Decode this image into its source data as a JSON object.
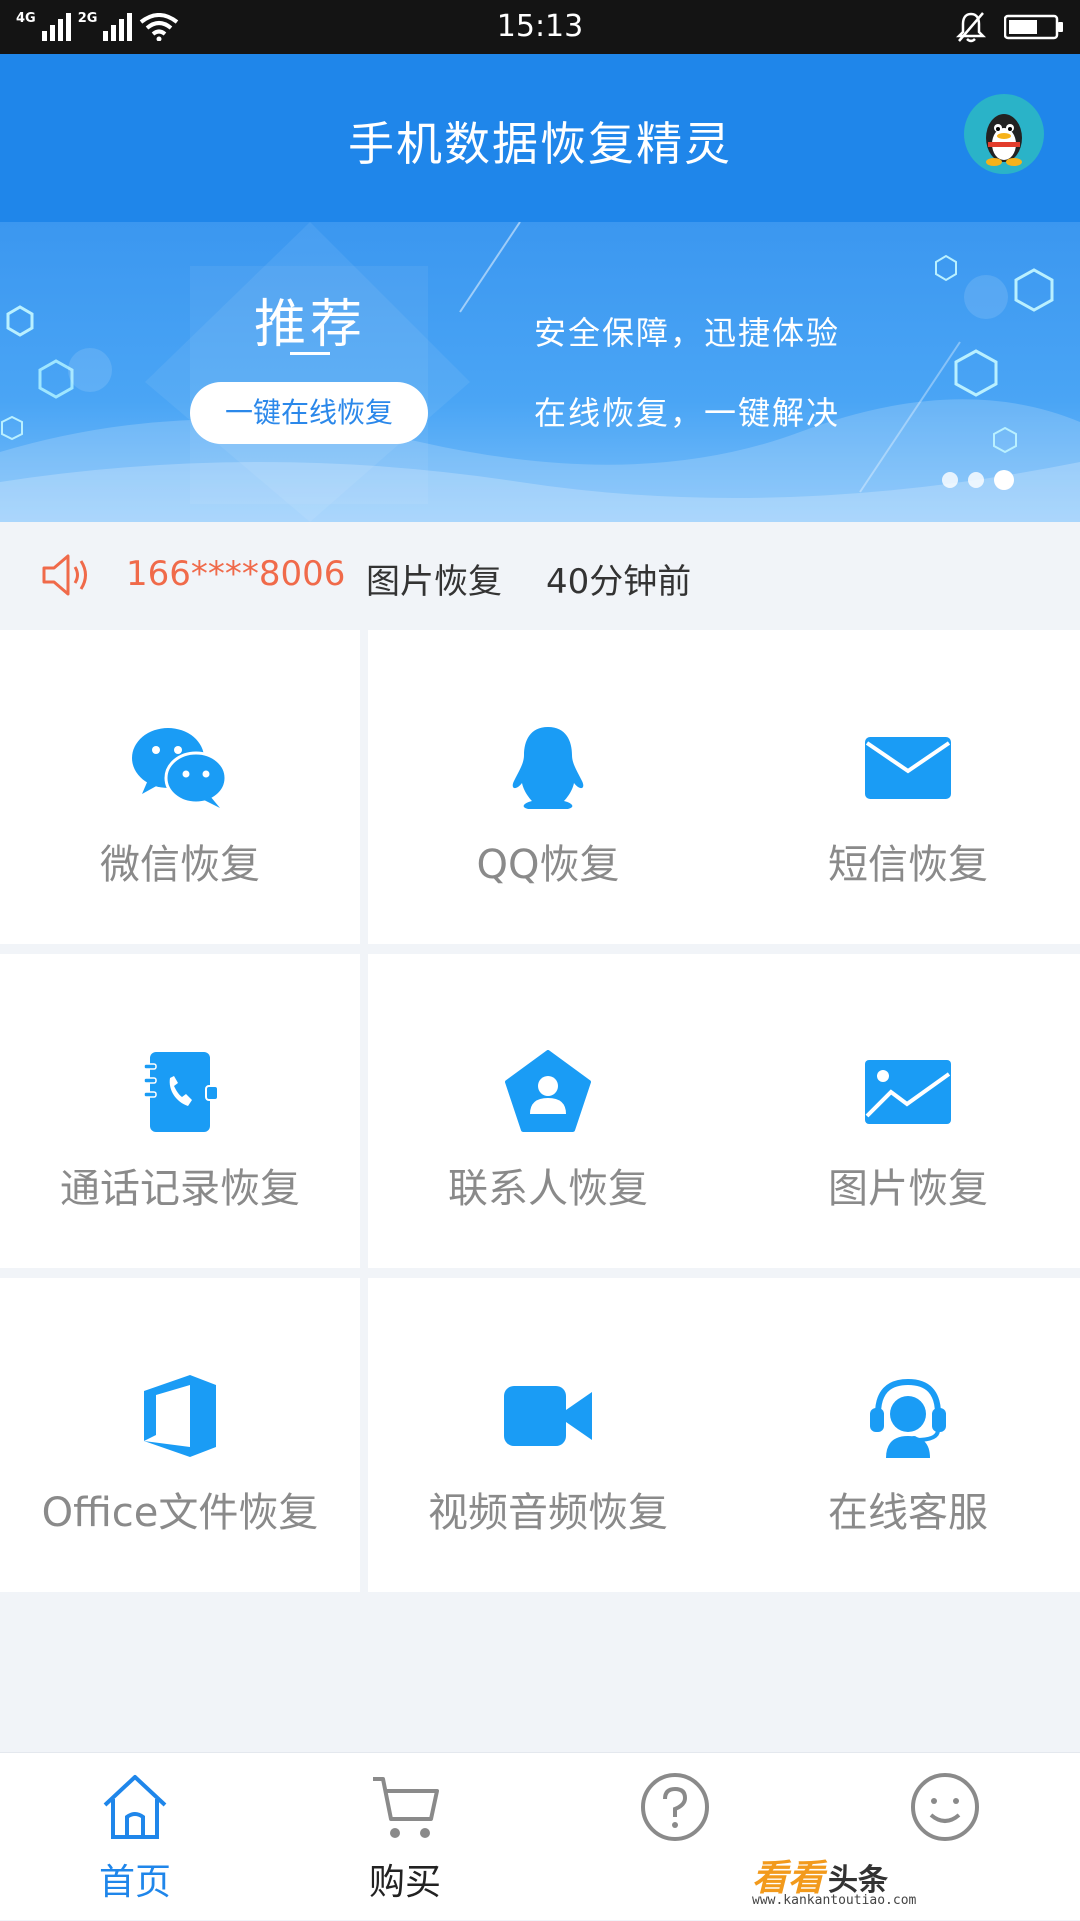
{
  "status_bar": {
    "net1": "4G",
    "net2": "2G",
    "time": "15:13"
  },
  "header": {
    "title": "手机数据恢复精灵"
  },
  "banner": {
    "recommend_title": "推荐",
    "recommend_button": "一键在线恢复",
    "slogan_1": "安全保障，迅捷体验",
    "slogan_2": "在线恢复，一键解决"
  },
  "notice": {
    "phone": "166****8006",
    "type": "图片恢复",
    "time": "40分钟前"
  },
  "grid": {
    "items": [
      {
        "label": "微信恢复",
        "icon": "wechat-icon"
      },
      {
        "label": "QQ恢复",
        "icon": "qq-icon"
      },
      {
        "label": "短信恢复",
        "icon": "sms-icon"
      },
      {
        "label": "通话记录恢复",
        "icon": "call-log-icon"
      },
      {
        "label": "联系人恢复",
        "icon": "contact-icon"
      },
      {
        "label": "图片恢复",
        "icon": "image-icon"
      },
      {
        "label": "Office文件恢复",
        "icon": "office-icon"
      },
      {
        "label": "视频音频恢复",
        "icon": "video-icon"
      },
      {
        "label": "在线客服",
        "icon": "support-icon"
      }
    ]
  },
  "bottom_nav": {
    "items": [
      {
        "label": "首页",
        "icon": "home-icon",
        "active": true
      },
      {
        "label": "购买",
        "icon": "cart-icon"
      },
      {
        "label": "",
        "icon": "help-icon"
      },
      {
        "label": "",
        "icon": "smile-icon"
      }
    ]
  },
  "watermark": {
    "main": "看看",
    "sub": "头条",
    "url": "www.kankantoutiao.com"
  },
  "colors": {
    "primary": "#1f86ea",
    "icon_blue": "#1a9cf5",
    "notice_red": "#f06a4a",
    "watermark_orange": "#f29a1c"
  }
}
